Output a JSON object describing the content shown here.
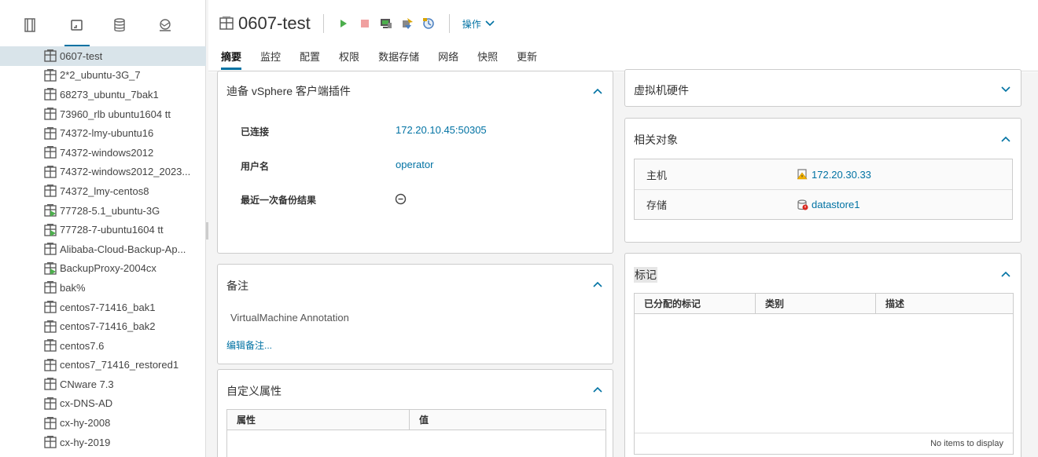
{
  "nav_tabs": [
    {
      "icon": "hosts-clusters-icon",
      "active": false
    },
    {
      "icon": "vms-templates-icon",
      "active": true
    },
    {
      "icon": "storage-icon",
      "active": false
    },
    {
      "icon": "networking-icon",
      "active": false
    }
  ],
  "tree": [
    {
      "label": "0607-test",
      "state": "off",
      "selected": true
    },
    {
      "label": "2*2_ubuntu-3G_7",
      "state": "off"
    },
    {
      "label": "68273_ubuntu_7bak1",
      "state": "off"
    },
    {
      "label": "73960_rlb ubuntu1604 tt",
      "state": "off"
    },
    {
      "label": "74372-lmy-ubuntu16",
      "state": "off"
    },
    {
      "label": "74372-windows2012",
      "state": "off"
    },
    {
      "label": "74372-windows2012_2023...",
      "state": "off"
    },
    {
      "label": "74372_lmy-centos8",
      "state": "off"
    },
    {
      "label": "77728-5.1_ubuntu-3G",
      "state": "on"
    },
    {
      "label": "77728-7-ubuntu1604 tt",
      "state": "on"
    },
    {
      "label": "Alibaba-Cloud-Backup-Ap...",
      "state": "off"
    },
    {
      "label": "BackupProxy-2004cx",
      "state": "on"
    },
    {
      "label": "bak%",
      "state": "off"
    },
    {
      "label": "centos7-71416_bak1",
      "state": "off"
    },
    {
      "label": "centos7-71416_bak2",
      "state": "off"
    },
    {
      "label": "centos7.6",
      "state": "off"
    },
    {
      "label": "centos7_71416_restored1",
      "state": "off"
    },
    {
      "label": "CNware 7.3",
      "state": "off"
    },
    {
      "label": "cx-DNS-AD",
      "state": "off"
    },
    {
      "label": "cx-hy-2008",
      "state": "off"
    },
    {
      "label": "cx-hy-2019",
      "state": "off"
    }
  ],
  "header": {
    "vm_name": "0607-test",
    "actions_label": "操作"
  },
  "tabs": [
    "摘要",
    "监控",
    "配置",
    "权限",
    "数据存储",
    "网络",
    "快照",
    "更新"
  ],
  "plugin_card": {
    "title": "迪备 vSphere 客户端插件",
    "connected_label": "已连接",
    "connected_value": "172.20.10.45:50305",
    "username_label": "用户名",
    "username_value": "operator",
    "last_backup_label": "最近一次备份结果"
  },
  "notes_card": {
    "title": "备注",
    "annotation": "VirtualMachine Annotation",
    "edit_link": "编辑备注..."
  },
  "custom_attrs_card": {
    "title": "自定义属性",
    "columns": [
      "属性",
      "值"
    ]
  },
  "hardware_card": {
    "title": "虚拟机硬件"
  },
  "related_card": {
    "title": "相关对象",
    "rows": [
      {
        "key": "主机",
        "value": "172.20.30.33",
        "icon": "host-warning-icon"
      },
      {
        "key": "存储",
        "value": "datastore1",
        "icon": "datastore-error-icon"
      }
    ]
  },
  "tags_card": {
    "title": "标记",
    "columns": [
      "已分配的标记",
      "类别",
      "描述"
    ],
    "empty_text": "No items to display"
  },
  "colors": {
    "accent": "#0072a3",
    "play": "#4cae4c",
    "stop": "#f0a0a0",
    "warning": "#f4b400",
    "error": "#d9261c"
  }
}
